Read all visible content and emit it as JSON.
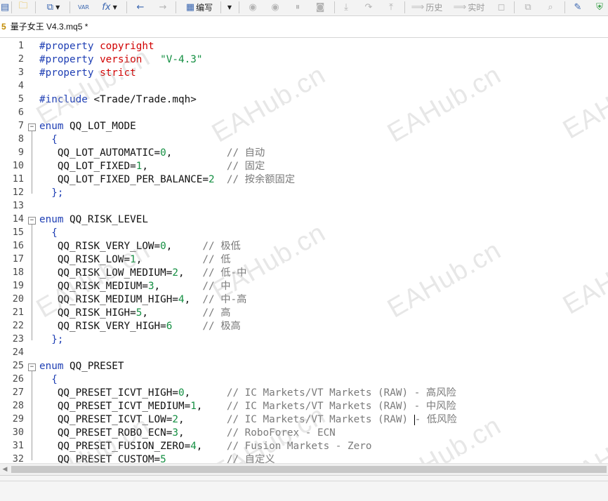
{
  "toolbar": {
    "compile_label": "编写",
    "history_label": "历史",
    "realtime_label": "实时",
    "var_label": "VAR",
    "fx_label": "fx"
  },
  "tab": {
    "number": "5",
    "title": "量子女王 V4.3.mq5 *"
  },
  "watermark": "EAHub.cn",
  "lines": [
    {
      "n": "1",
      "t": [
        [
          "p",
          "#property"
        ],
        [
          "d",
          " "
        ],
        [
          "r",
          "copyright"
        ]
      ]
    },
    {
      "n": "2",
      "t": [
        [
          "p",
          "#property"
        ],
        [
          "d",
          " "
        ],
        [
          "r",
          "version"
        ],
        [
          "d",
          "   "
        ],
        [
          "s",
          "\"V-4.3\""
        ]
      ]
    },
    {
      "n": "3",
      "t": [
        [
          "p",
          "#property"
        ],
        [
          "d",
          " "
        ],
        [
          "r",
          "strict"
        ]
      ]
    },
    {
      "n": "4",
      "t": []
    },
    {
      "n": "5",
      "t": [
        [
          "p",
          "#include"
        ],
        [
          "d",
          " <Trade/Trade.mqh>"
        ]
      ]
    },
    {
      "n": "6",
      "t": []
    },
    {
      "n": "7",
      "fold": true,
      "t": [
        [
          "k",
          "enum"
        ],
        [
          "d",
          " QQ_LOT_MODE"
        ]
      ]
    },
    {
      "n": "8",
      "t": [
        [
          "k",
          "  {"
        ]
      ]
    },
    {
      "n": "9",
      "t": [
        [
          "d",
          "   QQ_LOT_AUTOMATIC="
        ],
        [
          "n",
          "0"
        ],
        [
          "d",
          ",         "
        ],
        [
          "c",
          "// 自动"
        ]
      ]
    },
    {
      "n": "10",
      "t": [
        [
          "d",
          "   QQ_LOT_FIXED="
        ],
        [
          "n",
          "1"
        ],
        [
          "d",
          ",             "
        ],
        [
          "c",
          "// 固定"
        ]
      ]
    },
    {
      "n": "11",
      "t": [
        [
          "d",
          "   QQ_LOT_FIXED_PER_BALANCE="
        ],
        [
          "n",
          "2"
        ],
        [
          "d",
          "  "
        ],
        [
          "c",
          "// 按余额固定"
        ]
      ]
    },
    {
      "n": "12",
      "t": [
        [
          "k",
          "  };"
        ]
      ]
    },
    {
      "n": "13",
      "t": []
    },
    {
      "n": "14",
      "fold": true,
      "t": [
        [
          "k",
          "enum"
        ],
        [
          "d",
          " QQ_RISK_LEVEL"
        ]
      ]
    },
    {
      "n": "15",
      "t": [
        [
          "k",
          "  {"
        ]
      ]
    },
    {
      "n": "16",
      "t": [
        [
          "d",
          "   QQ_RISK_VERY_LOW="
        ],
        [
          "n",
          "0"
        ],
        [
          "d",
          ",     "
        ],
        [
          "c",
          "// 极低"
        ]
      ]
    },
    {
      "n": "17",
      "t": [
        [
          "d",
          "   QQ_RISK_LOW="
        ],
        [
          "n",
          "1"
        ],
        [
          "d",
          ",          "
        ],
        [
          "c",
          "// 低"
        ]
      ]
    },
    {
      "n": "18",
      "t": [
        [
          "d",
          "   QQ_RISK_LOW_MEDIUM="
        ],
        [
          "n",
          "2"
        ],
        [
          "d",
          ",   "
        ],
        [
          "c",
          "// 低-中"
        ]
      ]
    },
    {
      "n": "19",
      "t": [
        [
          "d",
          "   QQ_RISK_MEDIUM="
        ],
        [
          "n",
          "3"
        ],
        [
          "d",
          ",       "
        ],
        [
          "c",
          "// 中"
        ]
      ]
    },
    {
      "n": "20",
      "t": [
        [
          "d",
          "   QQ_RISK_MEDIUM_HIGH="
        ],
        [
          "n",
          "4"
        ],
        [
          "d",
          ",  "
        ],
        [
          "c",
          "// 中-高"
        ]
      ]
    },
    {
      "n": "21",
      "t": [
        [
          "d",
          "   QQ_RISK_HIGH="
        ],
        [
          "n",
          "5"
        ],
        [
          "d",
          ",         "
        ],
        [
          "c",
          "// 高"
        ]
      ]
    },
    {
      "n": "22",
      "t": [
        [
          "d",
          "   QQ_RISK_VERY_HIGH="
        ],
        [
          "n",
          "6"
        ],
        [
          "d",
          "     "
        ],
        [
          "c",
          "// 极高"
        ]
      ]
    },
    {
      "n": "23",
      "t": [
        [
          "k",
          "  };"
        ]
      ]
    },
    {
      "n": "24",
      "t": []
    },
    {
      "n": "25",
      "fold": true,
      "t": [
        [
          "k",
          "enum"
        ],
        [
          "d",
          " QQ_PRESET"
        ]
      ]
    },
    {
      "n": "26",
      "t": [
        [
          "k",
          "  {"
        ]
      ]
    },
    {
      "n": "27",
      "t": [
        [
          "d",
          "   QQ_PRESET_ICVT_HIGH="
        ],
        [
          "n",
          "0"
        ],
        [
          "d",
          ",      "
        ],
        [
          "c",
          "// IC Markets/VT Markets (RAW) - 高风险"
        ]
      ]
    },
    {
      "n": "28",
      "t": [
        [
          "d",
          "   QQ_PRESET_ICVT_MEDIUM="
        ],
        [
          "n",
          "1"
        ],
        [
          "d",
          ",    "
        ],
        [
          "c",
          "// IC Markets/VT Markets (RAW) - 中风险"
        ]
      ]
    },
    {
      "n": "29",
      "t": [
        [
          "d",
          "   QQ_PRESET_ICVT_LOW="
        ],
        [
          "n",
          "2"
        ],
        [
          "d",
          ",       "
        ],
        [
          "c",
          "// IC Markets/VT Markets (RAW) "
        ],
        [
          "caret",
          ""
        ],
        [
          "c",
          "- 低风险"
        ]
      ]
    },
    {
      "n": "30",
      "t": [
        [
          "d",
          "   QQ_PRESET_ROBO_ECN="
        ],
        [
          "n",
          "3"
        ],
        [
          "d",
          ",       "
        ],
        [
          "c",
          "// RoboForex - ECN"
        ]
      ]
    },
    {
      "n": "31",
      "t": [
        [
          "d",
          "   QQ_PRESET_FUSION_ZERO="
        ],
        [
          "n",
          "4"
        ],
        [
          "d",
          ",    "
        ],
        [
          "c",
          "// Fusion Markets - Zero"
        ]
      ]
    },
    {
      "n": "32",
      "t": [
        [
          "d",
          "   QQ_PRESET_CUSTOM="
        ],
        [
          "n",
          "5"
        ],
        [
          "d",
          "          "
        ],
        [
          "c",
          "// 自定义"
        ]
      ]
    }
  ]
}
